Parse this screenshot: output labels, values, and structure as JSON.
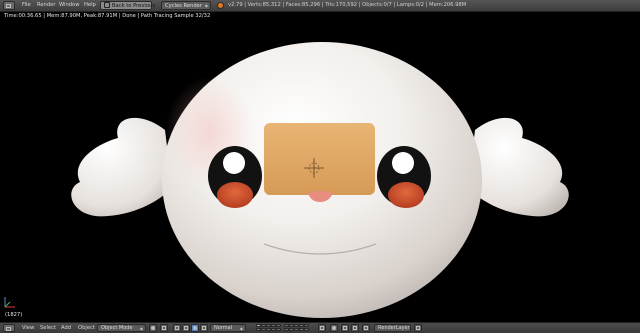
{
  "top_header": {
    "menu": [
      {
        "id": "file",
        "label": "File"
      },
      {
        "id": "render",
        "label": "Render"
      },
      {
        "id": "window",
        "label": "Window"
      },
      {
        "id": "help",
        "label": "Help"
      }
    ],
    "back_button_label": "Back to Previous",
    "render_engine": "Cycles Render",
    "stats": "v2.79 | Verts:85,312 | Faces:85,296 | Tris:170,592 | Objects:0/7 | Lamps:0/2 | Mem:206.98M"
  },
  "viewport": {
    "render_status": "Time:00:36.65 | Mem:87.90M, Peak:87.91M | Done | Path Tracing Sample 32/32",
    "frame_indicator": "(1827)"
  },
  "bottom_header": {
    "menu": [
      {
        "id": "view",
        "label": "View"
      },
      {
        "id": "select",
        "label": "Select"
      },
      {
        "id": "add",
        "label": "Add"
      },
      {
        "id": "object",
        "label": "Object"
      }
    ],
    "mode": "Object Mode",
    "transform_orientation": "Normal",
    "render_layer": "RenderLayer"
  },
  "colors": {
    "header_bg": "#444444",
    "viewport_bg": "#000000",
    "active_button": "#5680c2",
    "logo_orange": "#e07a20"
  }
}
